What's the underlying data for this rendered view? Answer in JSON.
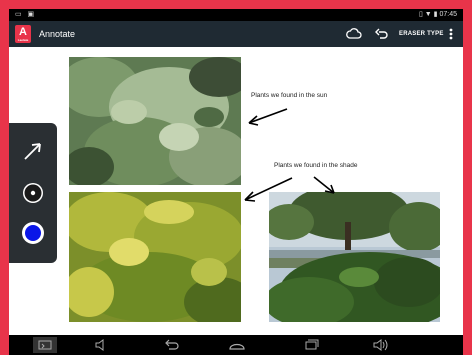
{
  "app": {
    "title": "Annotate",
    "logo_caption": "Laolate"
  },
  "toolbar": {
    "eraser_label": "ERASER TYPE"
  },
  "status": {
    "time": "07:45"
  },
  "annotations": {
    "sun_note": "Plants we found in the sun",
    "shade_note": "Plants we found in the shade"
  },
  "icons": {
    "cloud": "cloud-icon",
    "undo": "undo-icon",
    "overflow": "more-vert-icon",
    "arrow_tool": "arrow-tool-icon",
    "dot_tool": "dot-size-icon",
    "color_tool": "color-picker-icon"
  },
  "colors": {
    "brand": "#e8344a",
    "appbar": "#1f2a33",
    "selected_color": "#0a16e8"
  }
}
